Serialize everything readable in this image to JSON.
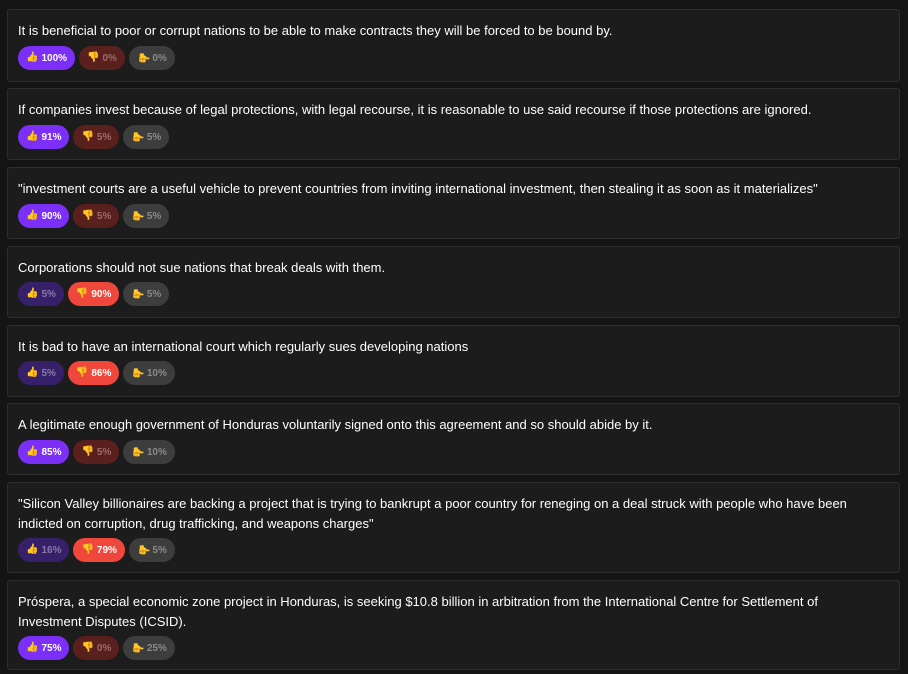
{
  "icons": {
    "agree": "thumbs-up-icon",
    "disagree": "thumbs-down-icon",
    "pass": "sideways-thumb-icon"
  },
  "colors": {
    "agree": "#7b2ff7",
    "disagree": "#f0473d",
    "pass": "#3d3d3d",
    "background": "#141414",
    "card": "#1c1c1c"
  },
  "statements": [
    {
      "text": "It is beneficial to poor or corrupt nations to be able to make contracts they will be forced to be bound by.",
      "agree": "100%",
      "disagree": "0%",
      "pass": "0%",
      "majority": "agree"
    },
    {
      "text": "If companies invest because of legal protections, with legal recourse, it is reasonable to use said recourse if those protections are ignored.",
      "agree": "91%",
      "disagree": "5%",
      "pass": "5%",
      "majority": "agree"
    },
    {
      "text": "\"investment courts are a useful vehicle to prevent countries from inviting international investment, then stealing it as soon as it materializes\"",
      "agree": "90%",
      "disagree": "5%",
      "pass": "5%",
      "majority": "agree"
    },
    {
      "text": "Corporations should not sue nations that break deals with them.",
      "agree": "5%",
      "disagree": "90%",
      "pass": "5%",
      "majority": "disagree"
    },
    {
      "text": "It is bad to have an international court which regularly sues developing nations",
      "agree": "5%",
      "disagree": "86%",
      "pass": "10%",
      "majority": "disagree"
    },
    {
      "text": "A legitimate enough government of Honduras voluntarily signed onto this agreement and so should abide by it.",
      "agree": "85%",
      "disagree": "5%",
      "pass": "10%",
      "majority": "agree"
    },
    {
      "text": "\"Silicon Valley billionaires are backing a project that is trying to bankrupt a poor country for reneging on a deal struck with people who have been indicted on corruption, drug trafficking, and weapons charges\"",
      "agree": "16%",
      "disagree": "79%",
      "pass": "5%",
      "majority": "disagree"
    },
    {
      "text": "Próspera, a special economic zone project in Honduras, is seeking $10.8 billion in arbitration from the International Centre for Settlement of Investment Disputes (ICSID).",
      "agree": "75%",
      "disagree": "0%",
      "pass": "25%",
      "majority": "agree"
    }
  ]
}
